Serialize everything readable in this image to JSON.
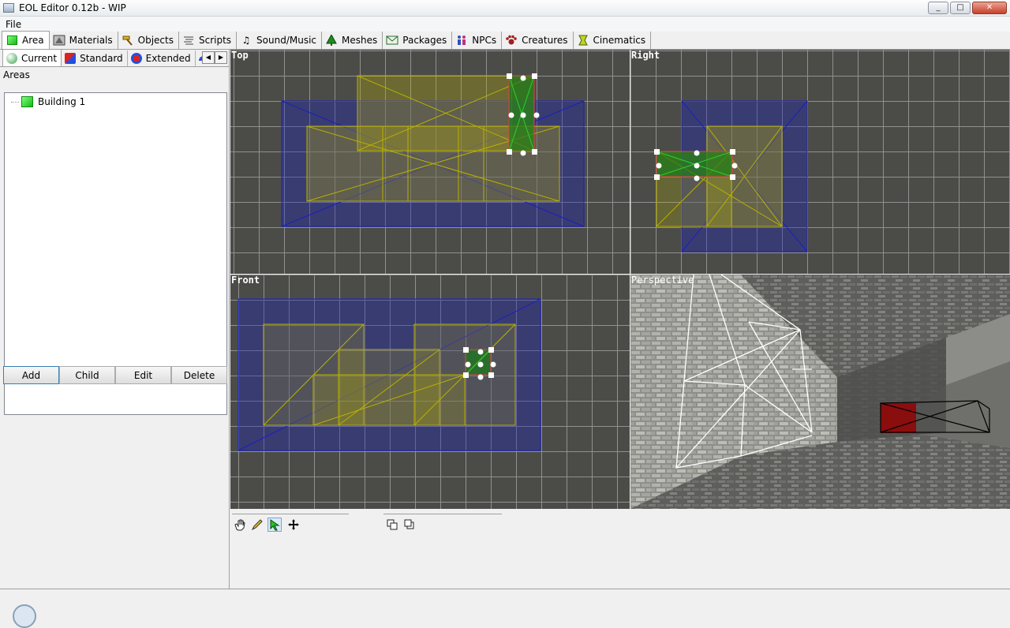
{
  "window": {
    "title": "EOL Editor 0.12b - WIP",
    "minimize": "_",
    "maximize": "□",
    "close": "✕"
  },
  "menu": {
    "file": "File"
  },
  "main_tabs": [
    {
      "label": "Area",
      "icon": "green-cube-icon",
      "active": true
    },
    {
      "label": "Materials",
      "icon": "materials-icon"
    },
    {
      "label": "Objects",
      "icon": "hammer-icon"
    },
    {
      "label": "Scripts",
      "icon": "scripts-icon"
    },
    {
      "label": "Sound/Music",
      "icon": "music-note-icon"
    },
    {
      "label": "Meshes",
      "icon": "tree-icon"
    },
    {
      "label": "Packages",
      "icon": "envelope-icon"
    },
    {
      "label": "NPCs",
      "icon": "people-icon"
    },
    {
      "label": "Creatures",
      "icon": "paw-icon"
    },
    {
      "label": "Cinematics",
      "icon": "film-icon"
    }
  ],
  "sub_tabs": [
    {
      "label": "Current",
      "active": true
    },
    {
      "label": "Standard"
    },
    {
      "label": "Extended"
    }
  ],
  "areas": {
    "label": "Areas",
    "items": [
      {
        "label": "Building 1",
        "icon": "green-cube-icon"
      }
    ]
  },
  "buttons": {
    "add": "Add",
    "child": "Child",
    "edit": "Edit",
    "delete": "Delete"
  },
  "viewports": {
    "top": "Top",
    "right": "Right",
    "front": "Front",
    "perspective": "Perspective"
  },
  "tools": [
    "hand-icon",
    "pencil-icon",
    "select-arrow-icon",
    "move-icon",
    "copy-icon",
    "paste-icon"
  ],
  "colors": {
    "viewport_bg": "#4b4c48",
    "grid": "#909090",
    "room_blue": "#1a1fbf",
    "brush_yellow": "#b8b000",
    "selection_green": "#1a7a1a"
  }
}
